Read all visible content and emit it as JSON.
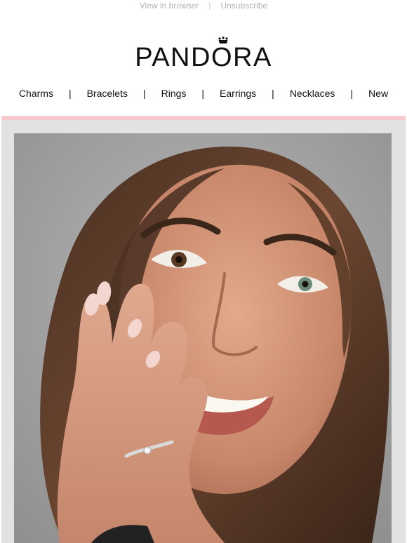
{
  "preheader": {
    "view_in_browser": "View in browser",
    "separator": "|",
    "unsubscribe": "Unsubscribe"
  },
  "brand": {
    "name": "PANDORA"
  },
  "nav": {
    "items": [
      {
        "label": "Charms"
      },
      {
        "label": "Bracelets"
      },
      {
        "label": "Rings"
      },
      {
        "label": "Earrings"
      },
      {
        "label": "Necklaces"
      },
      {
        "label": "New"
      }
    ],
    "separator": "|"
  },
  "colors": {
    "accent_pink": "#f6c9cf",
    "frame_grey": "#e2e2e2",
    "text": "#111111",
    "muted": "#b3b3b3"
  },
  "hero": {
    "image": "smiling-woman-with-ring-photo"
  }
}
